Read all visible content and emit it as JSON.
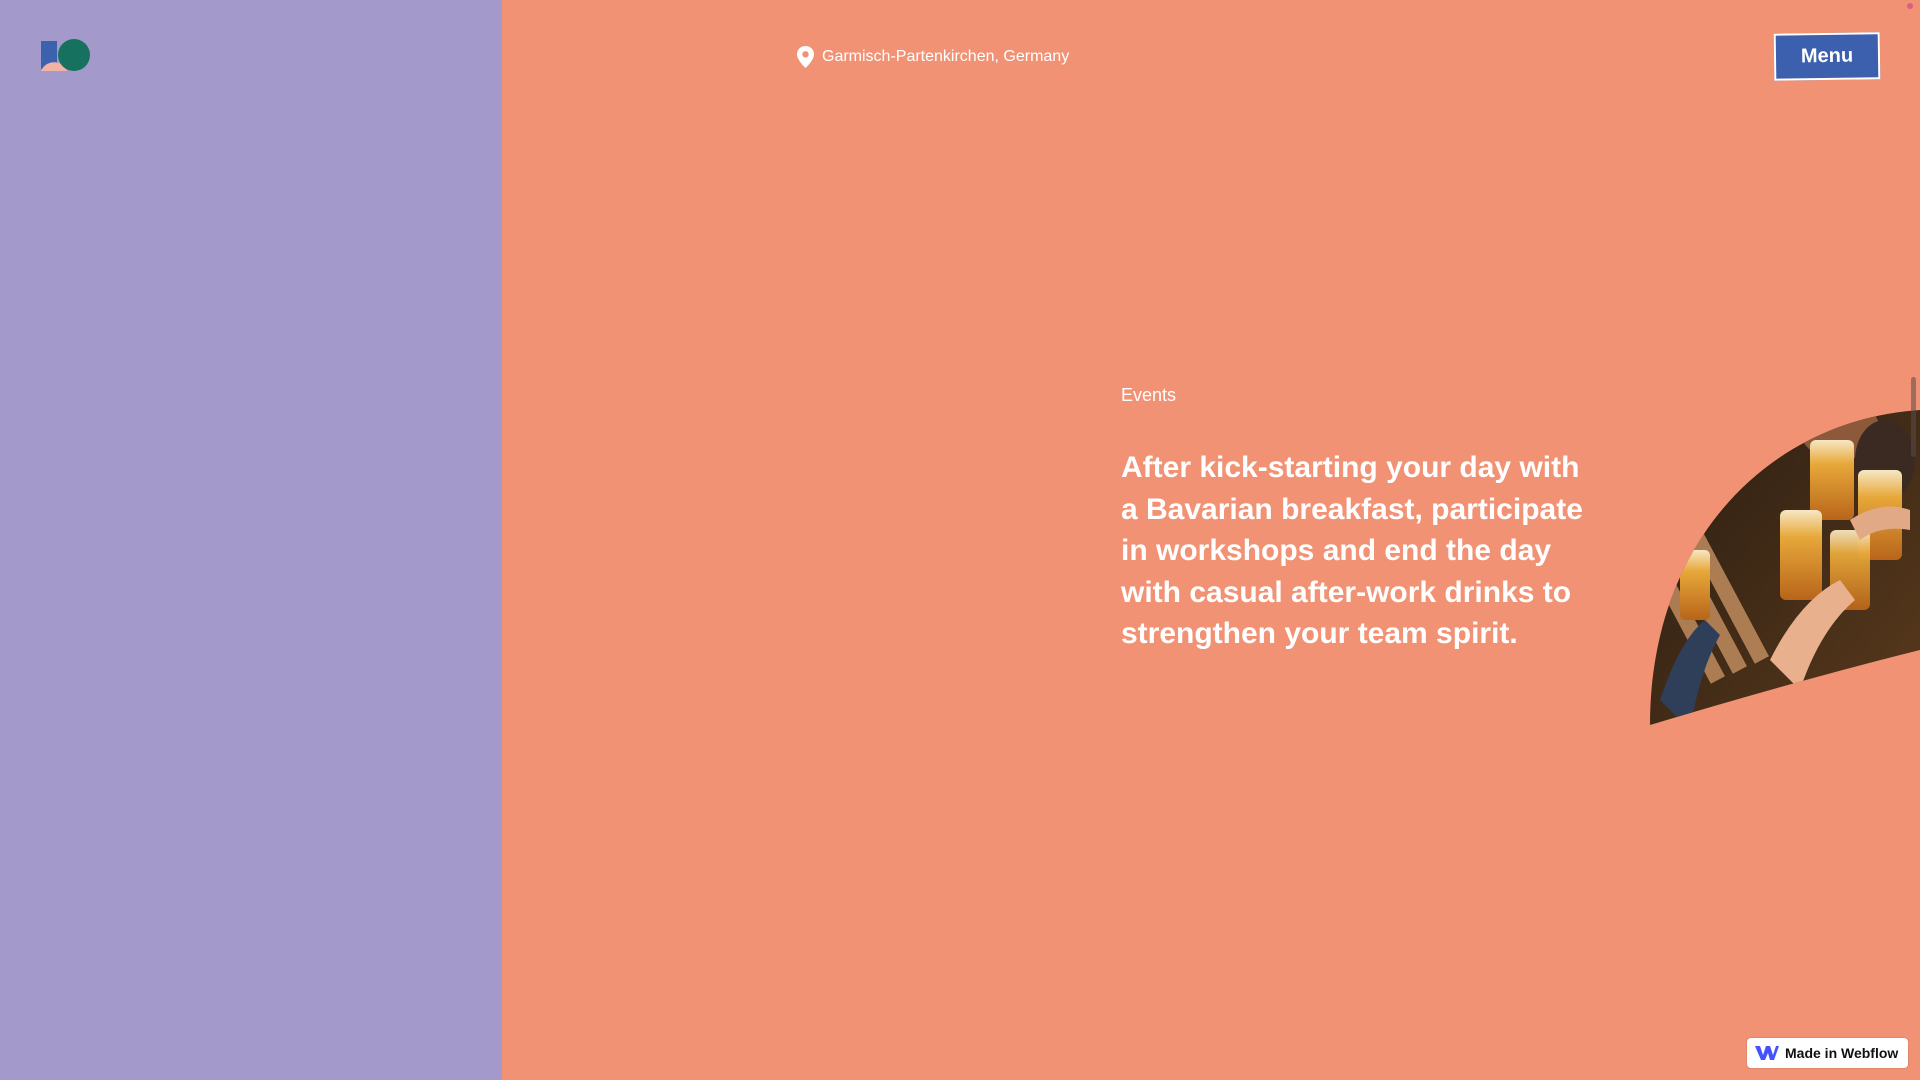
{
  "header": {
    "logo_icon": "brand-logo-icon",
    "location_icon": "map-pin-icon",
    "location_text": "Garmisch-Partenkirchen, Germany",
    "menu_label": "Menu"
  },
  "events": {
    "label": "Events",
    "text": "After kick-starting your day with a Bavarian breakfast, participate in workshops and end the day with casual after-work drinks to strengthen your team spirit."
  },
  "badge": {
    "icon": "webflow-logo-icon",
    "label": "Made in Webflow"
  },
  "colors": {
    "left_panel": "#a39acb",
    "right_panel": "#f29275",
    "menu_button": "#3c60ae",
    "text": "#ffffff"
  }
}
